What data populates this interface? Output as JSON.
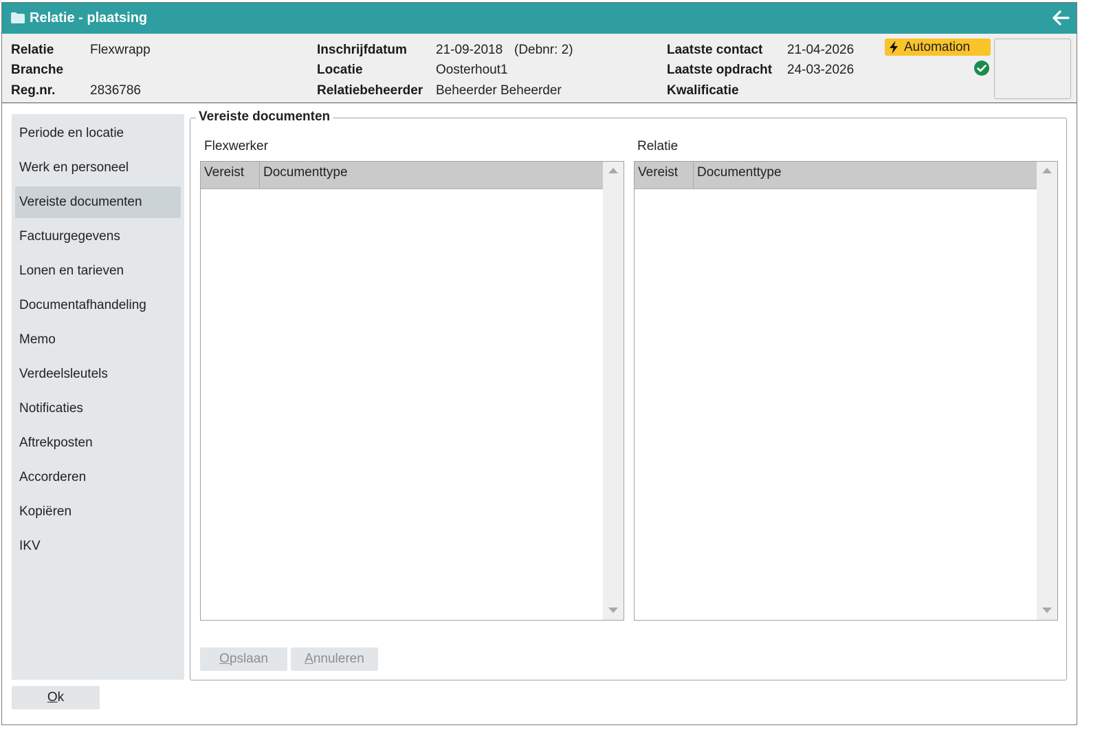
{
  "window": {
    "title": "Relatie - plaatsing"
  },
  "header": {
    "relatie_label": "Relatie",
    "relatie_value": "Flexwrapp",
    "branche_label": "Branche",
    "branche_value": "",
    "regnr_label": "Reg.nr.",
    "regnr_value": "2836786",
    "inschrijfdatum_label": "Inschrijfdatum",
    "inschrijfdatum_value": "21-09-2018",
    "debnr_value": "(Debnr: 2)",
    "locatie_label": "Locatie",
    "locatie_value": "Oosterhout1",
    "relatiebeheerder_label": "Relatiebeheerder",
    "relatiebeheerder_value": "Beheerder Beheerder",
    "laatste_contact_label": "Laatste contact",
    "laatste_contact_value": "21-04-2026",
    "laatste_opdracht_label": "Laatste opdracht",
    "laatste_opdracht_value": "24-03-2026",
    "kwalificatie_label": "Kwalificatie",
    "kwalificatie_value": "",
    "automation_label": "Automation",
    "status_icon": "check-circle-icon",
    "colors": {
      "titlebar": "#2e9ea0",
      "automation": "#f9c32a",
      "check": "#1a8c4e"
    }
  },
  "sidebar": {
    "items": [
      {
        "label": "Periode en locatie"
      },
      {
        "label": "Werk en personeel"
      },
      {
        "label": "Vereiste documenten",
        "active": true
      },
      {
        "label": "Factuurgegevens"
      },
      {
        "label": "Lonen en tarieven"
      },
      {
        "label": "Documentafhandeling"
      },
      {
        "label": "Memo"
      },
      {
        "label": "Verdeelsleutels"
      },
      {
        "label": "Notificaties"
      },
      {
        "label": "Aftrekposten"
      },
      {
        "label": "Accorderen"
      },
      {
        "label": "Kopiëren"
      },
      {
        "label": "IKV"
      }
    ]
  },
  "main": {
    "group_title": "Vereiste documenten",
    "flexwerker": {
      "label": "Flexwerker",
      "columns": [
        "Vereist",
        "Documenttype"
      ],
      "rows": []
    },
    "relatie": {
      "label": "Relatie",
      "columns": [
        "Vereist",
        "Documenttype"
      ],
      "rows": []
    },
    "buttons": {
      "opslaan_mnemonic": "O",
      "opslaan_rest": "pslaan",
      "annuleren_mnemonic": "A",
      "annuleren_rest": "nnuleren"
    }
  },
  "footer": {
    "ok_mnemonic": "O",
    "ok_rest": "k"
  }
}
